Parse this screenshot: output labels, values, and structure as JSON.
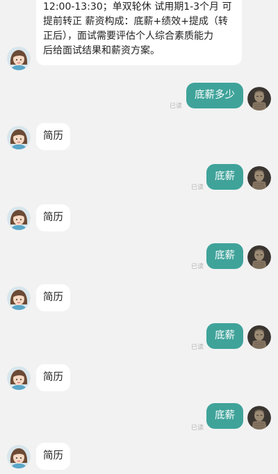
{
  "colors": {
    "sent_bubble": "#3fa39a",
    "background": "#f2f2f2"
  },
  "messages": {
    "m0": {
      "lines": [
        "12:00-13:30；单双轮休 试用期1-3个月 可",
        "提前转正 薪资构成：底薪+绩效+提成（转",
        "正后），面试需要评估个人综合素质能力",
        "后给面试结果和薪资方案。"
      ]
    },
    "m1": {
      "text": "底薪多少",
      "status": "已读"
    },
    "m2": {
      "text": "简历"
    },
    "m3": {
      "text": "底薪",
      "status": "已读"
    },
    "m4": {
      "text": "简历"
    },
    "m5": {
      "text": "底薪",
      "status": "已读"
    },
    "m6": {
      "text": "简历"
    },
    "m7": {
      "text": "底薪",
      "status": "已读"
    },
    "m8": {
      "text": "简历"
    },
    "m9": {
      "text": "底薪",
      "status": "已读"
    },
    "m10": {
      "text": "简历"
    }
  }
}
